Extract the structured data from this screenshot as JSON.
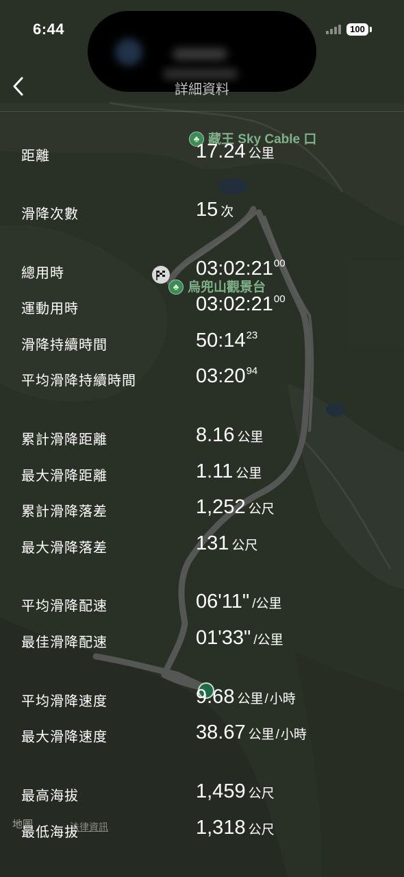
{
  "status_bar": {
    "time": "6:44",
    "battery": "100"
  },
  "nav": {
    "title": "詳細資料"
  },
  "map": {
    "poi_top": "藏王 Sky Cable 口",
    "poi_mid": "烏兜山觀景台",
    "legal_brand": "地圖",
    "legal_link": "法律資訊"
  },
  "stats": {
    "distance": {
      "label": "距離",
      "value": "17.24",
      "unit": "公里"
    },
    "runs": {
      "label": "滑降次數",
      "value": "15",
      "unit": "次"
    },
    "total_time": {
      "label": "總用時",
      "value": "03:02:21",
      "fraction": "00"
    },
    "active_time": {
      "label": "運動用時",
      "value": "03:02:21",
      "fraction": "00"
    },
    "descent_duration": {
      "label": "滑降持續時間",
      "value": "50:14",
      "fraction": "23"
    },
    "avg_descent_duration": {
      "label": "平均滑降持續時間",
      "value": "03:20",
      "fraction": "94"
    },
    "total_descent_distance": {
      "label": "累計滑降距離",
      "value": "8.16",
      "unit": "公里"
    },
    "max_descent_distance": {
      "label": "最大滑降距離",
      "value": "1.11",
      "unit": "公里"
    },
    "total_descent_drop": {
      "label": "累計滑降落差",
      "value": "1,252",
      "unit": "公尺"
    },
    "max_descent_drop": {
      "label": "最大滑降落差",
      "value": "131",
      "unit": "公尺"
    },
    "avg_descent_pace": {
      "label": "平均滑降配速",
      "value": "06'11\"",
      "unit": "/公里"
    },
    "best_descent_pace": {
      "label": "最佳滑降配速",
      "value": "01'33\"",
      "unit": "/公里"
    },
    "avg_descent_speed": {
      "label": "平均滑降速度",
      "value": "9.68",
      "unit": "公里",
      "unit2": "小時"
    },
    "max_descent_speed": {
      "label": "最大滑降速度",
      "value": "38.67",
      "unit": "公里",
      "unit2": "小時"
    },
    "max_altitude": {
      "label": "最高海拔",
      "value": "1,459",
      "unit": "公尺"
    },
    "min_altitude": {
      "label": "最低海拔",
      "value": "1,318",
      "unit": "公尺"
    }
  }
}
